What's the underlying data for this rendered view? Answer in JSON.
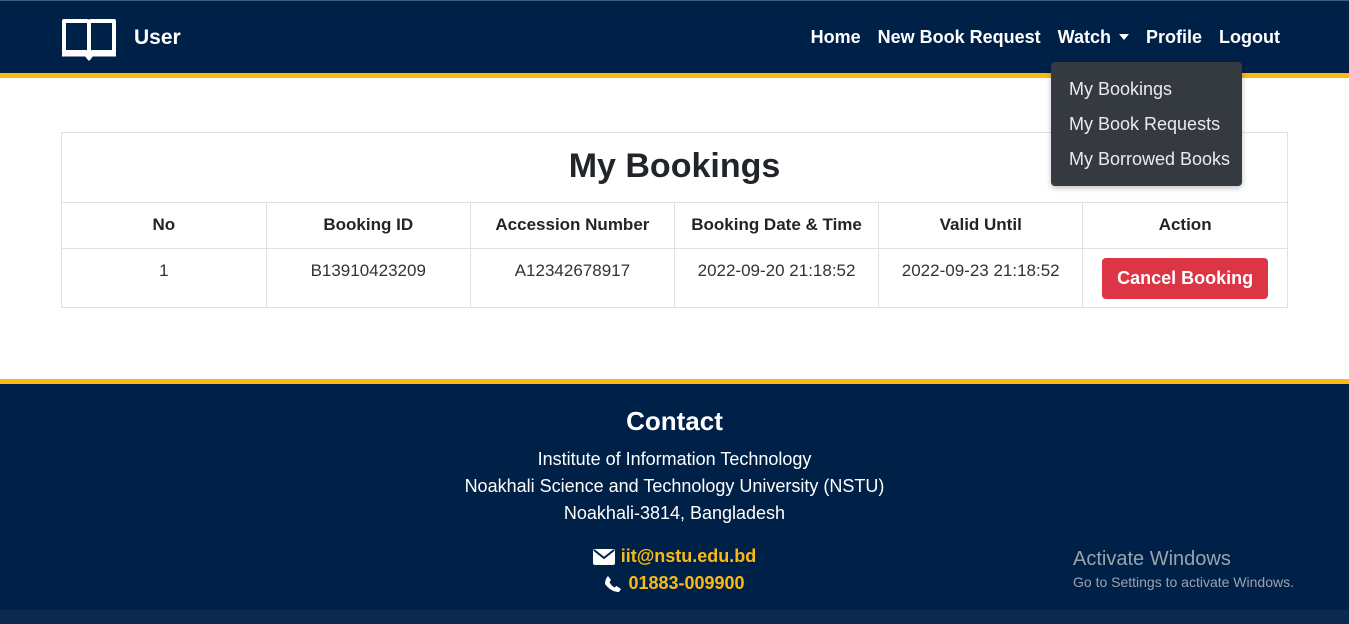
{
  "brand": {
    "label": "User",
    "icon": "open-book-icon"
  },
  "nav": {
    "home": "Home",
    "new_book_request": "New Book Request",
    "watch": "Watch",
    "profile": "Profile",
    "logout": "Logout"
  },
  "dropdown": {
    "items": [
      "My Bookings",
      "My Book Requests",
      "My Borrowed Books"
    ]
  },
  "bookings": {
    "title": "My Bookings",
    "columns": [
      "No",
      "Booking ID",
      "Accession Number",
      "Booking Date & Time",
      "Valid Until",
      "Action"
    ],
    "rows": [
      {
        "no": "1",
        "booking_id": "B13910423209",
        "accession": "A12342678917",
        "booking_date": "2022-09-20 21:18:52",
        "valid_until": "2022-09-23 21:18:52",
        "action": "Cancel Booking"
      }
    ]
  },
  "footer": {
    "title": "Contact",
    "address": [
      "Institute of Information Technology",
      "Noakhali Science and Technology University (NSTU)",
      "Noakhali-3814, Bangladesh"
    ],
    "email": "iit@nstu.edu.bd",
    "phone": "01883-009900"
  },
  "watermark": {
    "line1": "Activate Windows",
    "line2": "Go to Settings to activate Windows."
  },
  "colors": {
    "navy": "#002147",
    "gold": "#fdb913",
    "danger": "#dc3545",
    "dropdown_bg": "#343a40"
  }
}
